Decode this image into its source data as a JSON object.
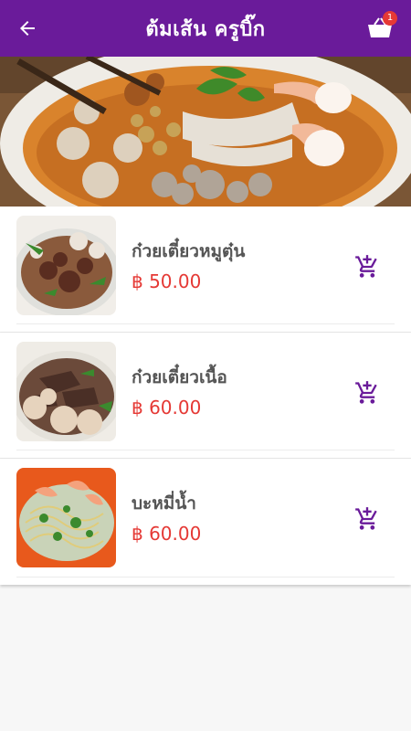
{
  "appbar": {
    "title": "ต้มเส้น ครูบิ๊ก",
    "cart_count": "1"
  },
  "colors": {
    "primary": "#6a1b9a",
    "price": "#e53935",
    "badge": "#e53935"
  },
  "icons": {
    "back": "arrow-left-icon",
    "cart": "basket-icon",
    "add": "add-to-cart-icon"
  },
  "menu": [
    {
      "name": "ก๋วยเตี๋ยวหมูตุ๋น",
      "price": "฿ 50.00"
    },
    {
      "name": "ก๋วยเตี๋ยวเนื้อ",
      "price": "฿ 60.00"
    },
    {
      "name": "บะหมี่น้ำ",
      "price": "฿ 60.00"
    }
  ]
}
